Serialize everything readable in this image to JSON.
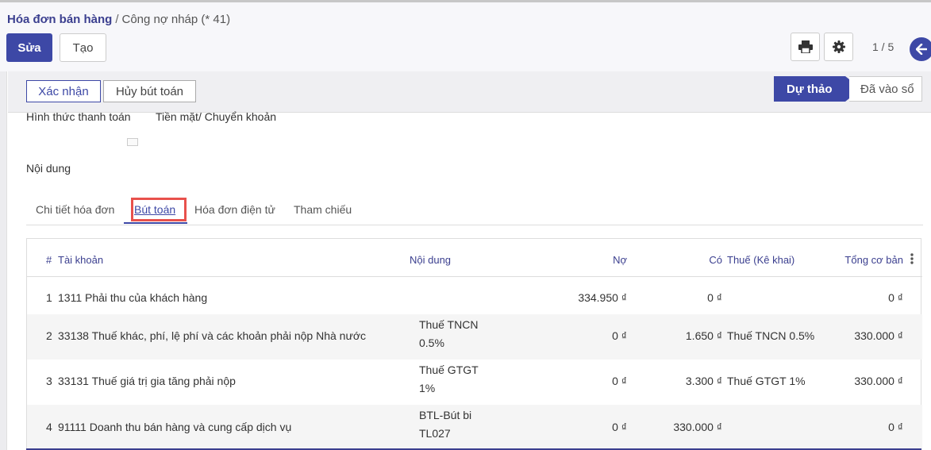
{
  "breadcrumb": {
    "parent": "Hóa đơn bán hàng",
    "separator": "/",
    "current": "Công nợ nháp (* 41)"
  },
  "toolbar": {
    "edit_label": "Sửa",
    "create_label": "Tạo",
    "pager": "1 / 5",
    "print_icon": "printer-icon",
    "settings_icon": "gear-icon",
    "back_icon": "arrow-left-icon"
  },
  "statusbar": {
    "confirm_label": "Xác nhận",
    "cancel_label": "Hủy bút toán",
    "stages": [
      "Dự thảo",
      "Đã vào sổ"
    ],
    "active_stage": "Dự thảo"
  },
  "form": {
    "payment_label": "Hình thức thanh toán",
    "payment_value": "Tiền mặt/ Chuyển khoản",
    "content_label": "Nội dung"
  },
  "tabs": [
    "Chi tiết hóa đơn",
    "Bút toán",
    "Hóa đơn điện tử",
    "Tham chiếu"
  ],
  "active_tab": "Bút toán",
  "table": {
    "headers": {
      "num": "#",
      "account": "Tài khoản",
      "memo": "Nội dung",
      "debit": "Nợ",
      "credit": "Có",
      "tax": "Thuế (Kê khai)",
      "base": "Tổng cơ bản"
    },
    "rows": [
      {
        "num": "1",
        "account": "1311 Phải thu của khách hàng",
        "memo1": "",
        "memo2": "",
        "debit": "334.950 ₫",
        "credit": "0 ₫",
        "tax": "",
        "base": "0 ₫"
      },
      {
        "num": "2",
        "account": "33138 Thuế khác, phí, lệ phí và các khoản phải nộp Nhà nước",
        "memo1": "Thuế TNCN",
        "memo2": "0.5%",
        "debit": "0 ₫",
        "credit": "1.650 ₫",
        "tax": "Thuế TNCN 0.5%",
        "base": "330.000 ₫"
      },
      {
        "num": "3",
        "account": "33131 Thuế giá trị gia tăng phải nộp",
        "memo1": "Thuế GTGT",
        "memo2": "1%",
        "debit": "0 ₫",
        "credit": "3.300 ₫",
        "tax": "Thuế GTGT 1%",
        "base": "330.000 ₫"
      },
      {
        "num": "4",
        "account": "91111 Doanh thu bán hàng và cung cấp dịch vụ",
        "memo1": "BTL-Bút bi",
        "memo2": "TL027",
        "debit": "0 ₫",
        "credit": "330.000 ₫",
        "tax": "",
        "base": "0 ₫"
      }
    ]
  },
  "colors": {
    "primary": "#3d48a6",
    "highlight": "#e8514c"
  }
}
